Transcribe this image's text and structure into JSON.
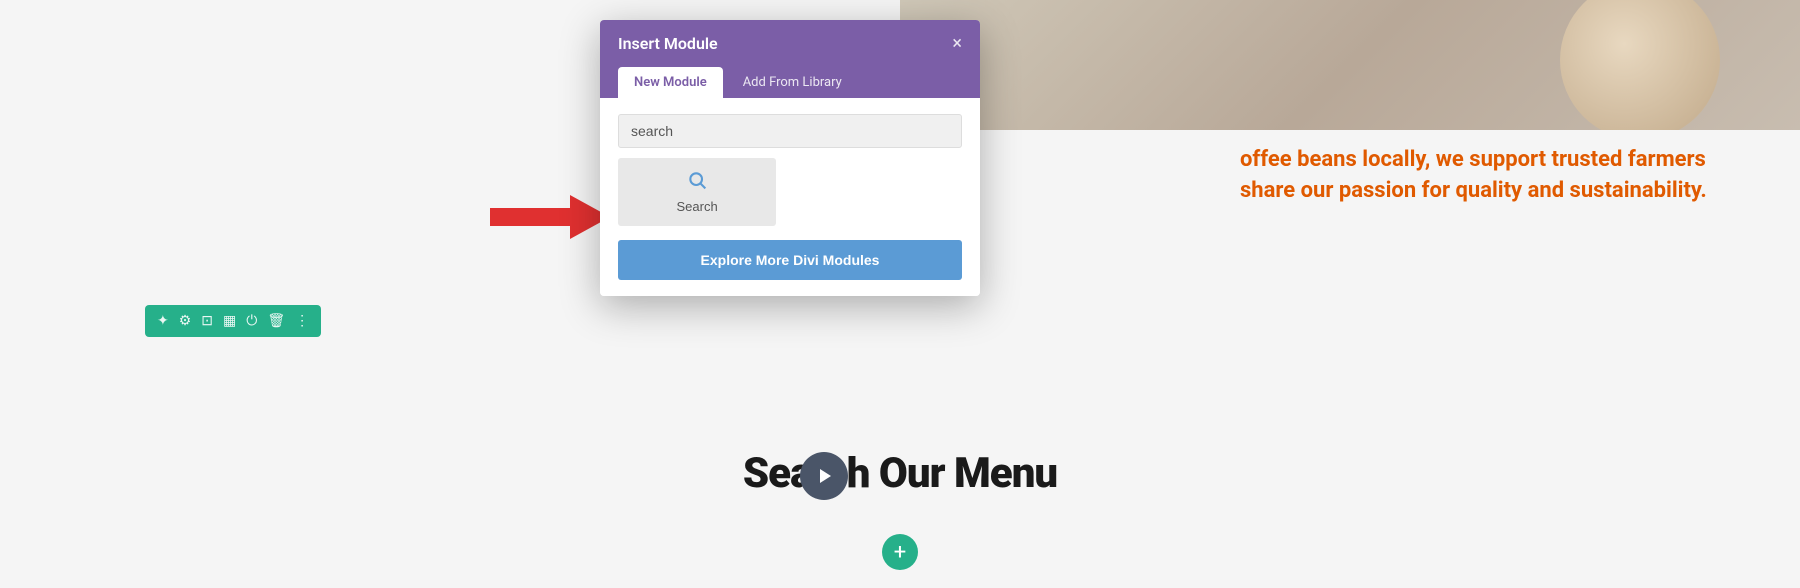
{
  "modal": {
    "title": "Insert Module",
    "close_icon": "×",
    "tabs": [
      {
        "label": "New Module",
        "active": true
      },
      {
        "label": "Add From Library",
        "active": false
      }
    ],
    "search_placeholder": "search",
    "search_button_label": "Search",
    "explore_button_label": "Explore More Divi Modules"
  },
  "background": {
    "text_line1": "offee beans locally, we support trusted farmers",
    "text_line2": "share our passion for quality and sustainability."
  },
  "toolbar": {
    "icons": [
      "✦",
      "⚙",
      "⊡",
      "▦",
      "⏻",
      "🗑",
      "⋮"
    ]
  },
  "bottom": {
    "section_title": "Search Our Menu"
  },
  "colors": {
    "purple": "#7b5ea7",
    "teal": "#26b08a",
    "blue": "#5b9bd5",
    "orange": "#e05a00",
    "red_arrow": "#e03030"
  }
}
